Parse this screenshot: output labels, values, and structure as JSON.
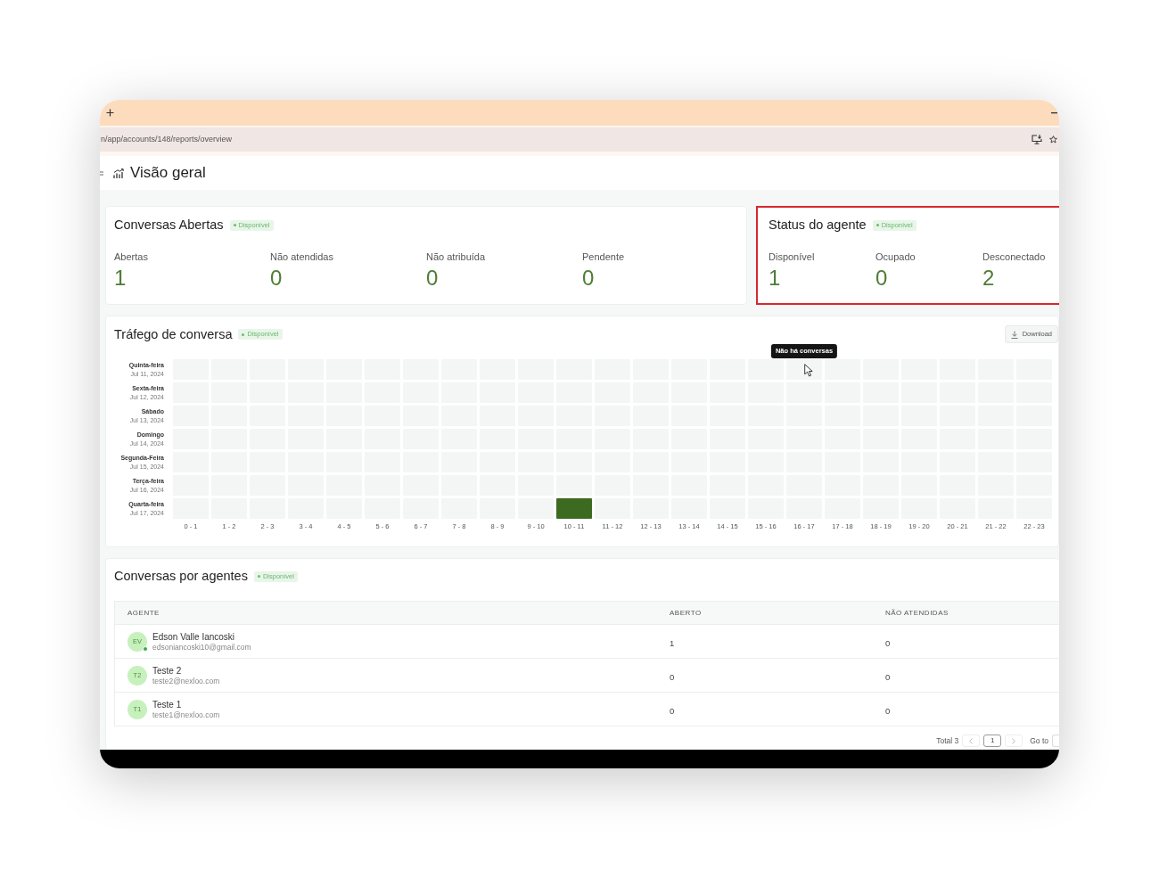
{
  "browser": {
    "url": "n/app/accounts/148/reports/overview"
  },
  "page": {
    "title": "Visão geral"
  },
  "open_conversations": {
    "title": "Conversas Abertas",
    "badge": "Disponível",
    "metrics": [
      {
        "label": "Abertas",
        "value": "1"
      },
      {
        "label": "Não atendidas",
        "value": "0"
      },
      {
        "label": "Não atribuída",
        "value": "0"
      },
      {
        "label": "Pendente",
        "value": "0"
      }
    ]
  },
  "agent_status": {
    "title": "Status do agente",
    "badge": "Disponível",
    "highlighted": true,
    "metrics": [
      {
        "label": "Disponível",
        "value": "1"
      },
      {
        "label": "Ocupado",
        "value": "0"
      },
      {
        "label": "Desconectado",
        "value": "2"
      }
    ]
  },
  "traffic": {
    "title": "Tráfego de conversa",
    "badge": "Disponível",
    "download_button": "Download",
    "tooltip": "Não há conversas",
    "rows": [
      {
        "day": "Quinta-feira",
        "date": "Jul 11, 2024",
        "cells": [
          {
            "color": "#f3f6f5",
            "hovered": false
          },
          {
            "color": "#f3f6f5",
            "hovered": false
          },
          {
            "color": "#f3f6f5",
            "hovered": false
          },
          {
            "color": "#f3f6f5",
            "hovered": false
          },
          {
            "color": "#f3f6f5",
            "hovered": false
          },
          {
            "color": "#f3f6f5",
            "hovered": false
          },
          {
            "color": "#f3f6f5",
            "hovered": false
          },
          {
            "color": "#f3f6f5",
            "hovered": false
          },
          {
            "color": "#f3f6f5",
            "hovered": false
          },
          {
            "color": "#f3f6f5",
            "hovered": false
          },
          {
            "color": "#f3f6f5",
            "hovered": false
          },
          {
            "color": "#f3f6f5",
            "hovered": false
          },
          {
            "color": "#f3f6f5",
            "hovered": false
          },
          {
            "color": "#f3f6f5",
            "hovered": false
          },
          {
            "color": "#f3f6f5",
            "hovered": false
          },
          {
            "color": "#f3f6f5",
            "hovered": false
          },
          {
            "color": "#f3f6f5",
            "hovered": true
          },
          {
            "color": "#f3f6f5",
            "hovered": false
          },
          {
            "color": "#f3f6f5",
            "hovered": false
          },
          {
            "color": "#f3f6f5",
            "hovered": false
          },
          {
            "color": "#f3f6f5",
            "hovered": false
          },
          {
            "color": "#f3f6f5",
            "hovered": false
          },
          {
            "color": "#f3f6f5",
            "hovered": false
          }
        ]
      },
      {
        "day": "Sexta-feira",
        "date": "Jul 12, 2024",
        "cells": [
          {
            "color": "#f3f6f5",
            "hovered": false
          },
          {
            "color": "#f3f6f5",
            "hovered": false
          },
          {
            "color": "#f3f6f5",
            "hovered": false
          },
          {
            "color": "#f3f6f5",
            "hovered": false
          },
          {
            "color": "#f3f6f5",
            "hovered": false
          },
          {
            "color": "#f3f6f5",
            "hovered": false
          },
          {
            "color": "#f3f6f5",
            "hovered": false
          },
          {
            "color": "#f3f6f5",
            "hovered": false
          },
          {
            "color": "#f3f6f5",
            "hovered": false
          },
          {
            "color": "#f3f6f5",
            "hovered": false
          },
          {
            "color": "#f3f6f5",
            "hovered": false
          },
          {
            "color": "#f3f6f5",
            "hovered": false
          },
          {
            "color": "#f3f6f5",
            "hovered": false
          },
          {
            "color": "#f3f6f5",
            "hovered": false
          },
          {
            "color": "#f3f6f5",
            "hovered": false
          },
          {
            "color": "#f3f6f5",
            "hovered": false
          },
          {
            "color": "#f3f6f5",
            "hovered": false
          },
          {
            "color": "#f3f6f5",
            "hovered": false
          },
          {
            "color": "#f3f6f5",
            "hovered": false
          },
          {
            "color": "#f3f6f5",
            "hovered": false
          },
          {
            "color": "#f3f6f5",
            "hovered": false
          },
          {
            "color": "#f3f6f5",
            "hovered": false
          },
          {
            "color": "#f3f6f5",
            "hovered": false
          }
        ]
      },
      {
        "day": "Sábado",
        "date": "Jul 13, 2024",
        "cells": [
          {
            "color": "#f3f6f5",
            "hovered": false
          },
          {
            "color": "#f3f6f5",
            "hovered": false
          },
          {
            "color": "#f3f6f5",
            "hovered": false
          },
          {
            "color": "#f3f6f5",
            "hovered": false
          },
          {
            "color": "#f3f6f5",
            "hovered": false
          },
          {
            "color": "#f3f6f5",
            "hovered": false
          },
          {
            "color": "#f3f6f5",
            "hovered": false
          },
          {
            "color": "#f3f6f5",
            "hovered": false
          },
          {
            "color": "#f3f6f5",
            "hovered": false
          },
          {
            "color": "#f3f6f5",
            "hovered": false
          },
          {
            "color": "#f3f6f5",
            "hovered": false
          },
          {
            "color": "#f3f6f5",
            "hovered": false
          },
          {
            "color": "#f3f6f5",
            "hovered": false
          },
          {
            "color": "#f3f6f5",
            "hovered": false
          },
          {
            "color": "#f3f6f5",
            "hovered": false
          },
          {
            "color": "#f3f6f5",
            "hovered": false
          },
          {
            "color": "#f3f6f5",
            "hovered": false
          },
          {
            "color": "#f3f6f5",
            "hovered": false
          },
          {
            "color": "#f3f6f5",
            "hovered": false
          },
          {
            "color": "#f3f6f5",
            "hovered": false
          },
          {
            "color": "#f3f6f5",
            "hovered": false
          },
          {
            "color": "#f3f6f5",
            "hovered": false
          },
          {
            "color": "#f3f6f5",
            "hovered": false
          }
        ]
      },
      {
        "day": "Domingo",
        "date": "Jul 14, 2024",
        "cells": [
          {
            "color": "#f3f6f5",
            "hovered": false
          },
          {
            "color": "#f3f6f5",
            "hovered": false
          },
          {
            "color": "#f3f6f5",
            "hovered": false
          },
          {
            "color": "#f3f6f5",
            "hovered": false
          },
          {
            "color": "#f3f6f5",
            "hovered": false
          },
          {
            "color": "#f3f6f5",
            "hovered": false
          },
          {
            "color": "#f3f6f5",
            "hovered": false
          },
          {
            "color": "#f3f6f5",
            "hovered": false
          },
          {
            "color": "#f3f6f5",
            "hovered": false
          },
          {
            "color": "#f3f6f5",
            "hovered": false
          },
          {
            "color": "#f3f6f5",
            "hovered": false
          },
          {
            "color": "#f3f6f5",
            "hovered": false
          },
          {
            "color": "#f3f6f5",
            "hovered": false
          },
          {
            "color": "#f3f6f5",
            "hovered": false
          },
          {
            "color": "#f3f6f5",
            "hovered": false
          },
          {
            "color": "#f3f6f5",
            "hovered": false
          },
          {
            "color": "#f3f6f5",
            "hovered": false
          },
          {
            "color": "#f3f6f5",
            "hovered": false
          },
          {
            "color": "#f3f6f5",
            "hovered": false
          },
          {
            "color": "#f3f6f5",
            "hovered": false
          },
          {
            "color": "#f3f6f5",
            "hovered": false
          },
          {
            "color": "#f3f6f5",
            "hovered": false
          },
          {
            "color": "#f3f6f5",
            "hovered": false
          }
        ]
      },
      {
        "day": "Segunda-Feira",
        "date": "Jul 15, 2024",
        "cells": [
          {
            "color": "#f3f6f5",
            "hovered": false
          },
          {
            "color": "#f3f6f5",
            "hovered": false
          },
          {
            "color": "#f3f6f5",
            "hovered": false
          },
          {
            "color": "#f3f6f5",
            "hovered": false
          },
          {
            "color": "#f3f6f5",
            "hovered": false
          },
          {
            "color": "#f3f6f5",
            "hovered": false
          },
          {
            "color": "#f3f6f5",
            "hovered": false
          },
          {
            "color": "#f3f6f5",
            "hovered": false
          },
          {
            "color": "#f3f6f5",
            "hovered": false
          },
          {
            "color": "#f3f6f5",
            "hovered": false
          },
          {
            "color": "#f3f6f5",
            "hovered": false
          },
          {
            "color": "#f3f6f5",
            "hovered": false
          },
          {
            "color": "#f3f6f5",
            "hovered": false
          },
          {
            "color": "#f3f6f5",
            "hovered": false
          },
          {
            "color": "#f3f6f5",
            "hovered": false
          },
          {
            "color": "#f3f6f5",
            "hovered": false
          },
          {
            "color": "#f3f6f5",
            "hovered": false
          },
          {
            "color": "#f3f6f5",
            "hovered": false
          },
          {
            "color": "#f3f6f5",
            "hovered": false
          },
          {
            "color": "#f3f6f5",
            "hovered": false
          },
          {
            "color": "#f3f6f5",
            "hovered": false
          },
          {
            "color": "#f3f6f5",
            "hovered": false
          },
          {
            "color": "#f3f6f5",
            "hovered": false
          }
        ]
      },
      {
        "day": "Terça-feira",
        "date": "Jul 16, 2024",
        "cells": [
          {
            "color": "#f3f6f5",
            "hovered": false
          },
          {
            "color": "#f3f6f5",
            "hovered": false
          },
          {
            "color": "#f3f6f5",
            "hovered": false
          },
          {
            "color": "#f3f6f5",
            "hovered": false
          },
          {
            "color": "#f3f6f5",
            "hovered": false
          },
          {
            "color": "#f3f6f5",
            "hovered": false
          },
          {
            "color": "#f3f6f5",
            "hovered": false
          },
          {
            "color": "#f3f6f5",
            "hovered": false
          },
          {
            "color": "#f3f6f5",
            "hovered": false
          },
          {
            "color": "#f3f6f5",
            "hovered": false
          },
          {
            "color": "#f3f6f5",
            "hovered": false
          },
          {
            "color": "#f3f6f5",
            "hovered": false
          },
          {
            "color": "#f3f6f5",
            "hovered": false
          },
          {
            "color": "#f3f6f5",
            "hovered": false
          },
          {
            "color": "#f3f6f5",
            "hovered": false
          },
          {
            "color": "#f3f6f5",
            "hovered": false
          },
          {
            "color": "#f3f6f5",
            "hovered": false
          },
          {
            "color": "#f3f6f5",
            "hovered": false
          },
          {
            "color": "#f3f6f5",
            "hovered": false
          },
          {
            "color": "#f3f6f5",
            "hovered": false
          },
          {
            "color": "#f3f6f5",
            "hovered": false
          },
          {
            "color": "#f3f6f5",
            "hovered": false
          },
          {
            "color": "#f3f6f5",
            "hovered": false
          }
        ]
      },
      {
        "day": "Quarta-feira",
        "date": "Jul 17, 2024",
        "cells": [
          {
            "color": "#f3f6f5",
            "hovered": false
          },
          {
            "color": "#f3f6f5",
            "hovered": false
          },
          {
            "color": "#f3f6f5",
            "hovered": false
          },
          {
            "color": "#f3f6f5",
            "hovered": false
          },
          {
            "color": "#f3f6f5",
            "hovered": false
          },
          {
            "color": "#f3f6f5",
            "hovered": false
          },
          {
            "color": "#f3f6f5",
            "hovered": false
          },
          {
            "color": "#f3f6f5",
            "hovered": false
          },
          {
            "color": "#f3f6f5",
            "hovered": false
          },
          {
            "color": "#f3f6f5",
            "hovered": false
          },
          {
            "color": "#3d6a21",
            "hovered": false
          },
          {
            "color": "#f3f6f5",
            "hovered": false
          },
          {
            "color": "#f3f6f5",
            "hovered": false
          },
          {
            "color": "#f3f6f5",
            "hovered": false
          },
          {
            "color": "#f3f6f5",
            "hovered": false
          },
          {
            "color": "#f3f6f5",
            "hovered": false
          },
          {
            "color": "#f3f6f5",
            "hovered": false
          },
          {
            "color": "#f3f6f5",
            "hovered": false
          },
          {
            "color": "#f3f6f5",
            "hovered": false
          },
          {
            "color": "#f3f6f5",
            "hovered": false
          },
          {
            "color": "#f3f6f5",
            "hovered": false
          },
          {
            "color": "#f3f6f5",
            "hovered": false
          },
          {
            "color": "#f3f6f5",
            "hovered": false
          }
        ]
      }
    ],
    "columns": [
      "0 - 1",
      "1 - 2",
      "2 - 3",
      "3 - 4",
      "4 - 5",
      "5 - 6",
      "6 - 7",
      "7 - 8",
      "8 - 9",
      "9 - 10",
      "10 - 11",
      "11 - 12",
      "12 - 13",
      "13 - 14",
      "14 - 15",
      "15 - 16",
      "16 - 17",
      "17 - 18",
      "18 - 19",
      "19 - 20",
      "20 - 21",
      "21 - 22",
      "22 - 23"
    ]
  },
  "agents_table": {
    "title": "Conversas por agentes",
    "badge": "Disponível",
    "columns": [
      "AGENTE",
      "ABERTO",
      "NÃO ATENDIDAS"
    ],
    "rows": [
      {
        "initials": "EV",
        "online": true,
        "name": "Edson Valle Iancoski",
        "email": "edsoniancoski10@gmail.com",
        "open": "1",
        "unattended": "0"
      },
      {
        "initials": "T2",
        "online": false,
        "name": "Teste 2",
        "email": "teste2@nexloo.com",
        "open": "0",
        "unattended": "0"
      },
      {
        "initials": "T1",
        "online": false,
        "name": "Teste 1",
        "email": "teste1@nexloo.com",
        "open": "0",
        "unattended": "0"
      }
    ],
    "pagination": {
      "total": "Total 3",
      "pages": [
        {
          "label": "1",
          "selected": true
        }
      ],
      "goto_label": "Go to"
    }
  }
}
